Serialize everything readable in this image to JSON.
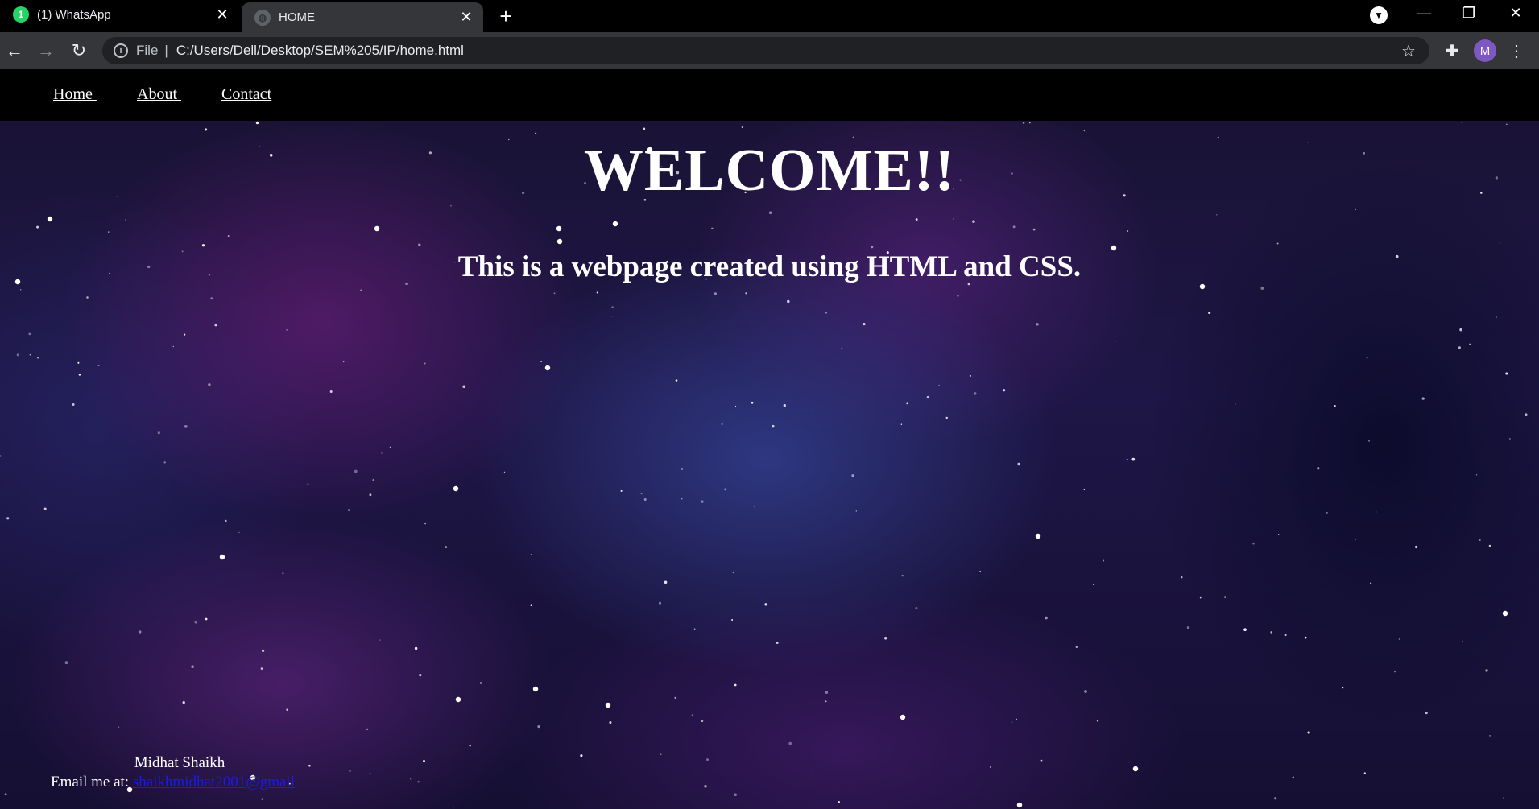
{
  "browser": {
    "tabs": [
      {
        "title": "(1) WhatsApp",
        "favicon": "whatsapp-icon",
        "badge": "1",
        "active": false
      },
      {
        "title": "HOME",
        "favicon": "globe-icon",
        "active": true
      }
    ],
    "new_tab": "+",
    "address_bar": {
      "scheme_label": "File",
      "url": "C:/Users/Dell/Desktop/SEM%205/IP/home.html"
    },
    "profile_initial": "M",
    "colors": {
      "tabstrip": "#000000",
      "toolbar": "#35363a",
      "omnibox": "#202124",
      "avatar": "#7e57c2"
    }
  },
  "site": {
    "nav": {
      "home": "Home ",
      "about": "About ",
      "contact": "Contact"
    },
    "hero": {
      "title": "WELCOME!!",
      "subtitle": "This is a webpage created using HTML and CSS."
    },
    "footer": {
      "name": "Midhat Shaikh",
      "email_prefix": "Email me at: ",
      "email_link": "shaikhmidhat2001@gmail"
    },
    "colors": {
      "nav_bg": "#000000",
      "text": "#ffffff",
      "link": "#1a1aee"
    }
  }
}
